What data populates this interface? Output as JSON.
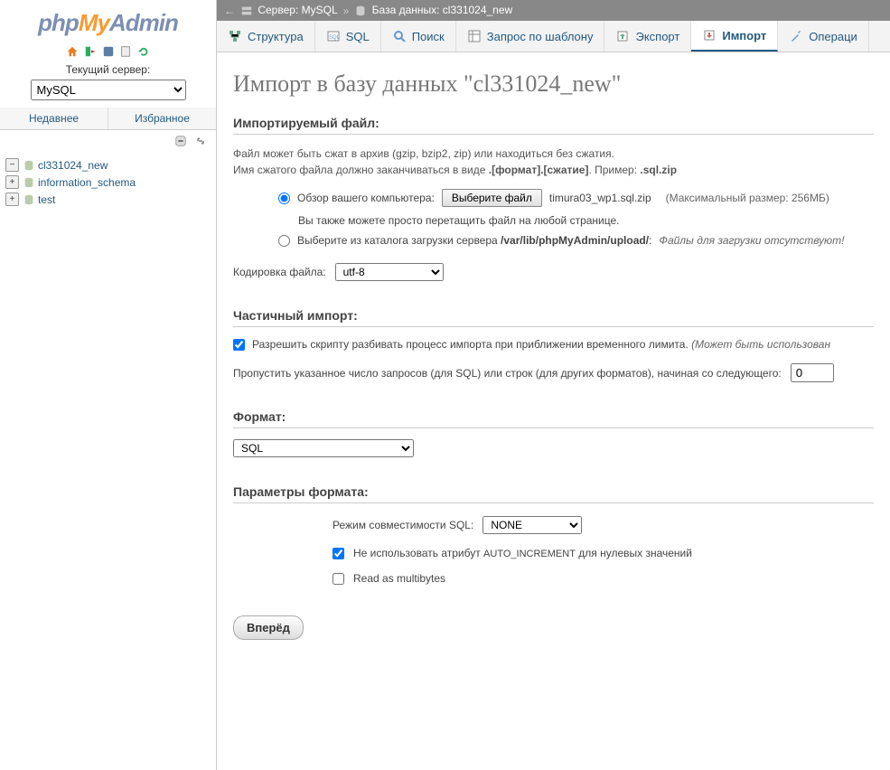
{
  "logo": {
    "php": "php",
    "my": "My",
    "admin": "Admin"
  },
  "sidebar": {
    "current_server_label": "Текущий сервер:",
    "server_value": "MySQL",
    "tabs": {
      "recent": "Недавнее",
      "favorite": "Избранное"
    },
    "tree": [
      {
        "name": "cl331024_new",
        "expanded": true
      },
      {
        "name": "information_schema",
        "expanded": false
      },
      {
        "name": "test",
        "expanded": false
      }
    ]
  },
  "breadcrumb": {
    "server_label": "Сервер: MySQL",
    "db_label": "База данных: cl331024_new"
  },
  "tabs": [
    {
      "id": "structure",
      "label": "Структура"
    },
    {
      "id": "sql",
      "label": "SQL"
    },
    {
      "id": "search",
      "label": "Поиск"
    },
    {
      "id": "query",
      "label": "Запрос по шаблону"
    },
    {
      "id": "export",
      "label": "Экспорт"
    },
    {
      "id": "import",
      "label": "Импорт",
      "active": true
    },
    {
      "id": "operations",
      "label": "Операци"
    }
  ],
  "page_title": "Импорт в базу данных \"cl331024_new\"",
  "import_file": {
    "section": "Импортируемый файл:",
    "hint1": "Файл может быть сжат в архив (gzip, bzip2, zip) или находиться без сжатия.",
    "hint2_a": "Имя сжатого файла должно заканчиваться в виде ",
    "hint2_b": ".[формат].[сжатие]",
    "hint2_c": ". Пример: ",
    "hint2_d": ".sql.zip",
    "browse_label": "Обзор вашего компьютера:",
    "choose_file": "Выберите файл",
    "chosen_file": "timura03_wp1.sql.zip",
    "max_size": "(Максимальный размер: 256МБ)",
    "drag_hint": "Вы также можете просто перетащить файл на любой странице.",
    "upload_dir_label": "Выберите из каталога загрузки сервера ",
    "upload_dir_path": "/var/lib/phpMyAdmin/upload/",
    "upload_dir_sep": ": ",
    "no_files": "Файлы для загрузки отсутствуют!",
    "charset_label": "Кодировка файла:",
    "charset_value": "utf-8"
  },
  "partial": {
    "section": "Частичный импорт:",
    "allow_interrupt": "Разрешить скрипту разбивать процесс импорта при приближении временного лимита. ",
    "allow_interrupt_note": "(Может быть использован",
    "skip_label": "Пропустить указанное число запросов (для SQL) или строк (для других форматов), начиная со следующего:",
    "skip_value": "0"
  },
  "format": {
    "section": "Формат:",
    "value": "SQL"
  },
  "format_params": {
    "section": "Параметры формата:",
    "compat_label": "Режим совместимости SQL:",
    "compat_value": "NONE",
    "no_autoinc_a": "Не использовать атрибут ",
    "no_autoinc_b": "AUTO_INCREMENT",
    "no_autoinc_c": " для нулевых значений",
    "read_multibytes": "Read as multibytes"
  },
  "submit": "Вперёд"
}
